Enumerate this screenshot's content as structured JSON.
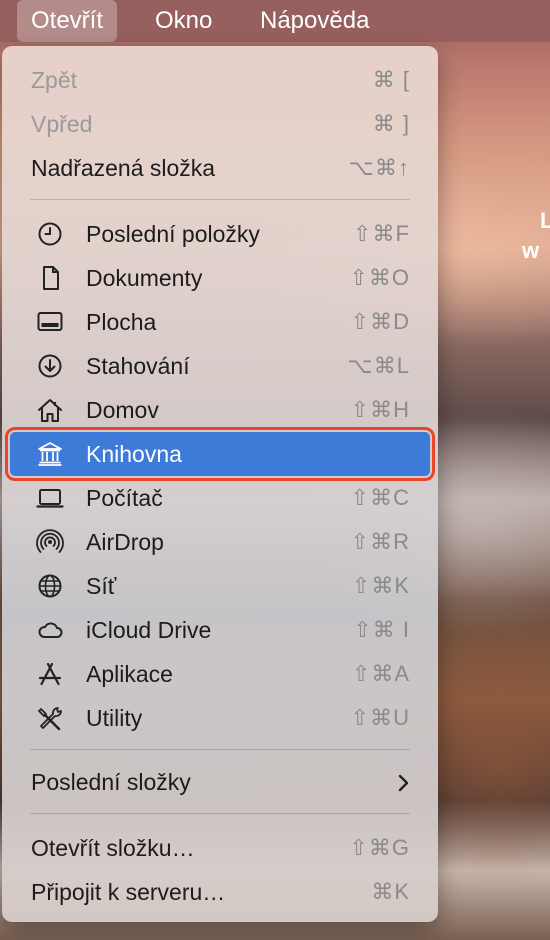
{
  "menubar": {
    "items": [
      {
        "label": "Otevřít"
      },
      {
        "label": "Okno"
      },
      {
        "label": "Nápověda"
      }
    ]
  },
  "watermark": {
    "line1": "L",
    "line2": "w"
  },
  "menu": {
    "nav": [
      {
        "label": "Zpět",
        "shortcut": "⌘ ["
      },
      {
        "label": "Vpřed",
        "shortcut": "⌘ ]"
      },
      {
        "label": "Nadřazená složka",
        "shortcut": "⌥⌘↑"
      }
    ],
    "places": [
      {
        "label": "Poslední položky",
        "shortcut": "⇧⌘F",
        "icon": "clock-icon"
      },
      {
        "label": "Dokumenty",
        "shortcut": "⇧⌘O",
        "icon": "document-icon"
      },
      {
        "label": "Plocha",
        "shortcut": "⇧⌘D",
        "icon": "desktop-icon"
      },
      {
        "label": "Stahování",
        "shortcut": "⌥⌘L",
        "icon": "download-icon"
      },
      {
        "label": "Domov",
        "shortcut": "⇧⌘H",
        "icon": "home-icon"
      },
      {
        "label": "Knihovna",
        "shortcut": "",
        "icon": "library-icon"
      },
      {
        "label": "Počítač",
        "shortcut": "⇧⌘C",
        "icon": "computer-icon"
      },
      {
        "label": "AirDrop",
        "shortcut": "⇧⌘R",
        "icon": "airdrop-icon"
      },
      {
        "label": "Síť",
        "shortcut": "⇧⌘K",
        "icon": "globe-icon"
      },
      {
        "label": "iCloud Drive",
        "shortcut": "⇧⌘ I",
        "icon": "cloud-icon"
      },
      {
        "label": "Aplikace",
        "shortcut": "⇧⌘A",
        "icon": "applications-icon"
      },
      {
        "label": "Utility",
        "shortcut": "⇧⌘U",
        "icon": "utilities-icon"
      }
    ],
    "recent": {
      "label": "Poslední složky"
    },
    "bottom": [
      {
        "label": "Otevřít složku…",
        "shortcut": "⇧⌘G"
      },
      {
        "label": "Připojit k serveru…",
        "shortcut": "⌘K"
      }
    ]
  },
  "colors": {
    "selection": "#3e7bd9",
    "highlight_outline": "#e8452a"
  }
}
